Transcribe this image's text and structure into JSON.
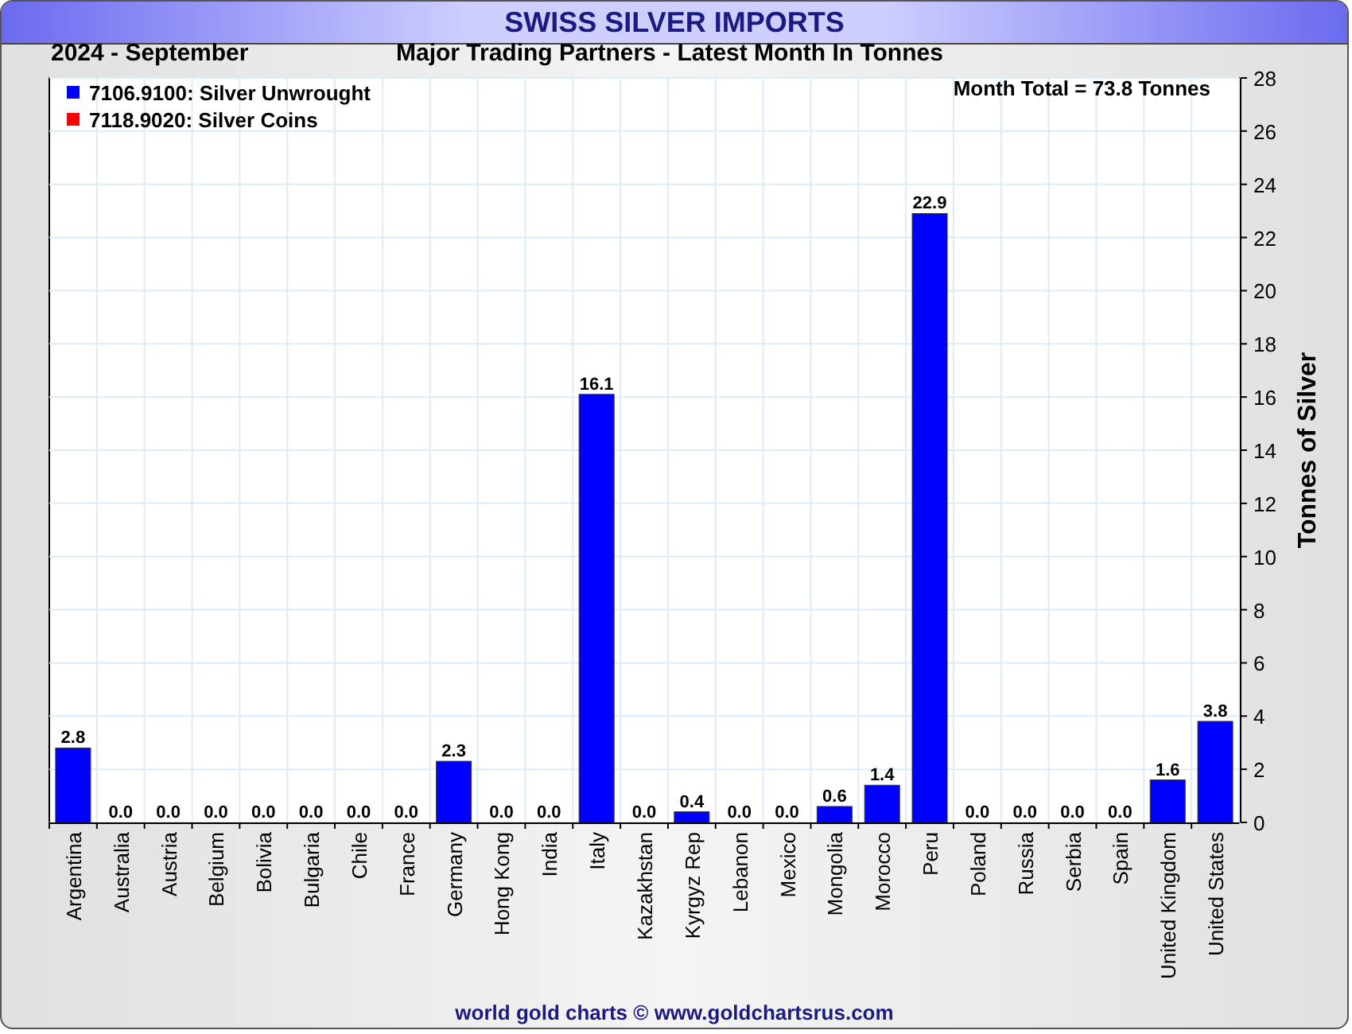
{
  "title": "SWISS SILVER IMPORTS",
  "period": "2024 - September",
  "chart": {
    "chart_data": {
      "type": "bar",
      "title": "Major Trading Partners - Latest Month In Tonnes",
      "ylabel": "Tonnes of Silver",
      "grid": true,
      "categories": [
        "Argentina",
        "Australia",
        "Austria",
        "Belgium",
        "Bolivia",
        "Bulgaria",
        "Chile",
        "France",
        "Germany",
        "Hong Kong",
        "India",
        "Italy",
        "Kazakhstan",
        "Kyrgyz Rep",
        "Lebanon",
        "Mexico",
        "Mongolia",
        "Morocco",
        "Peru",
        "Poland",
        "Russia",
        "Serbia",
        "Spain",
        "United Kingdom",
        "United States"
      ],
      "series": [
        {
          "name": "7106.9100: Silver Unwrought",
          "color": "#0000ff",
          "values": [
            2.8,
            0,
            0,
            0,
            0,
            0,
            0,
            0,
            2.3,
            0,
            0,
            16.1,
            0,
            0.4,
            0,
            0,
            0.6,
            1.4,
            22.9,
            0,
            0,
            0,
            0,
            1.6,
            3.8
          ]
        },
        {
          "name": "7118.9020: Silver Coins",
          "color": "#ff0000",
          "values": [
            null,
            null,
            null,
            null,
            null,
            null,
            null,
            null,
            null,
            null,
            null,
            null,
            null,
            null,
            null,
            null,
            null,
            null,
            null,
            null,
            null,
            null,
            null,
            null,
            null
          ]
        }
      ],
      "ylim": [
        0,
        28
      ],
      "yticks": [
        0,
        2,
        4,
        6,
        8,
        10,
        12,
        14,
        16,
        18,
        20,
        22,
        24,
        26,
        28
      ],
      "value_labels": [
        "2.8",
        "0.0",
        "0.0",
        "0.0",
        "0.0",
        "0.0",
        "0.0",
        "0.0",
        "2.3",
        "0.0",
        "0.0",
        "16.1",
        "0.0",
        "0.4",
        "0.0",
        "0.0",
        "0.6",
        "1.4",
        "22.9",
        "0.0",
        "0.0",
        "0.0",
        "0.0",
        "1.6",
        "3.8"
      ],
      "annotations": [
        "Month Total = 73.8 Tonnes"
      ]
    }
  },
  "footer": "world gold charts © www.goldchartsrus.com"
}
